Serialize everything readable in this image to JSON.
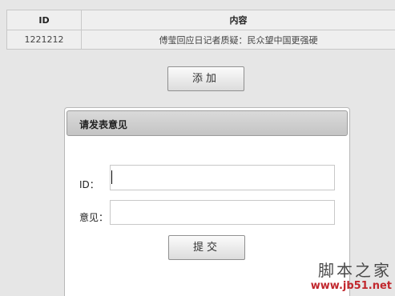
{
  "table": {
    "headers": {
      "id": "ID",
      "content": "内容"
    },
    "rows": [
      {
        "id": "1221212",
        "content": "傅莹回应日记者质疑：民众望中国更强硬"
      }
    ]
  },
  "add_button": {
    "label": "添加"
  },
  "dialog": {
    "title": "请发表意见",
    "id_label": "ID：",
    "opinion_label": "意见：",
    "id_value": "",
    "opinion_value": "",
    "submit_label": "提交"
  },
  "watermark": {
    "main": "脚本之家",
    "url": "www.jb51.net"
  }
}
